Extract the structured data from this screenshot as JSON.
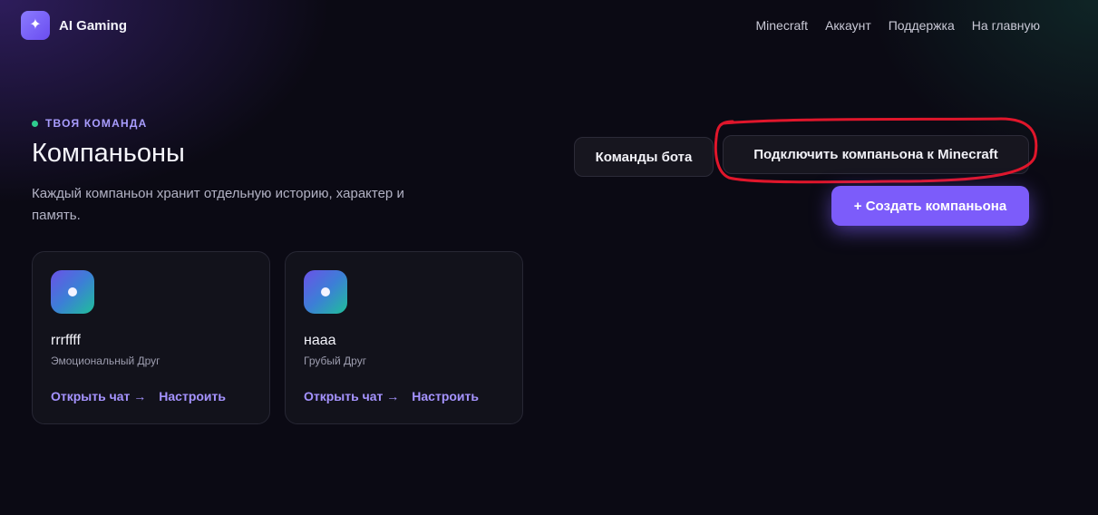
{
  "header": {
    "logo_icon": "sparkle-icon",
    "logo_glyph": "✦",
    "brand": "AI Gaming",
    "nav": [
      {
        "label": "Minecraft"
      },
      {
        "label": "Аккаунт"
      },
      {
        "label": "Поддержка"
      },
      {
        "label": "На главную"
      }
    ]
  },
  "hero": {
    "eyebrow": "ТВОЯ КОМАНДА",
    "title": "Компаньоны",
    "description": "Каждый компаньон хранит отдельную историю, характер и память."
  },
  "actions": {
    "bot_commands": "Команды бота",
    "connect_minecraft": "Подключить компаньона к Minecraft",
    "create_companion": "+ Создать компаньона"
  },
  "companions": [
    {
      "name": "rrrffff",
      "role": "Эмоциональный Друг",
      "open_chat": "Открыть чат →",
      "configure": "Настроить"
    },
    {
      "name": "наaa",
      "role": "Грубый Друг",
      "open_chat": "Открыть чат →",
      "configure": "Настроить"
    }
  ],
  "colors": {
    "accent": "#7c5cfa",
    "link": "#a593ff",
    "status_dot": "#2ecc8f",
    "highlight_ring": "#e0162b"
  }
}
